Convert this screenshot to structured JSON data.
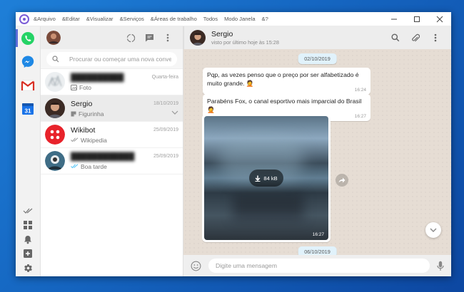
{
  "menu": [
    "&Arquivo",
    "&Editar",
    "&Visualizar",
    "&Serviços",
    "&Áreas de trabalho",
    "Todos",
    "Modo Janela",
    "&?"
  ],
  "services": [
    {
      "name": "WhatsApp",
      "icon": "whatsapp-icon",
      "color": "#25d366",
      "active": true
    },
    {
      "name": "Messenger",
      "icon": "messenger-icon",
      "color": "#1e88e5"
    },
    {
      "name": "Gmail",
      "icon": "gmail-icon",
      "color": "#d93025"
    },
    {
      "name": "Calendar",
      "icon": "calendar-icon",
      "color": "#1a73e8",
      "label": "31"
    }
  ],
  "search": {
    "placeholder": "Procurar ou começar uma nova conversa"
  },
  "chats": [
    {
      "name": "",
      "date": "Quarta-feira",
      "preview": "Foto",
      "blurred": true
    },
    {
      "name": "Sergio",
      "date": "18/10/2019",
      "preview": "Figurinha",
      "active": true
    },
    {
      "name": "Wikibot",
      "date": "25/09/2019",
      "preview": "Wikipedia"
    },
    {
      "name": "",
      "date": "25/09/2019",
      "preview": "Boa tarde",
      "blurred": true
    }
  ],
  "conversation": {
    "name": "Sergio",
    "status": "visto por último hoje às 15:28",
    "day1": "02/10/2019",
    "day2": "06/10/2019",
    "msg1": {
      "text": "Pqp, as vezes penso que o preço por ser alfabetizado é muito grande. 🤦",
      "time": "16:24"
    },
    "msg2": {
      "text": "Parabéns Fox, o canal esportivo mais imparcial do Brasil 🤦",
      "time": "16:27"
    },
    "media": {
      "size": "84 kB",
      "time": "16:27"
    }
  },
  "compose": {
    "placeholder": "Digite uma mensagem"
  }
}
